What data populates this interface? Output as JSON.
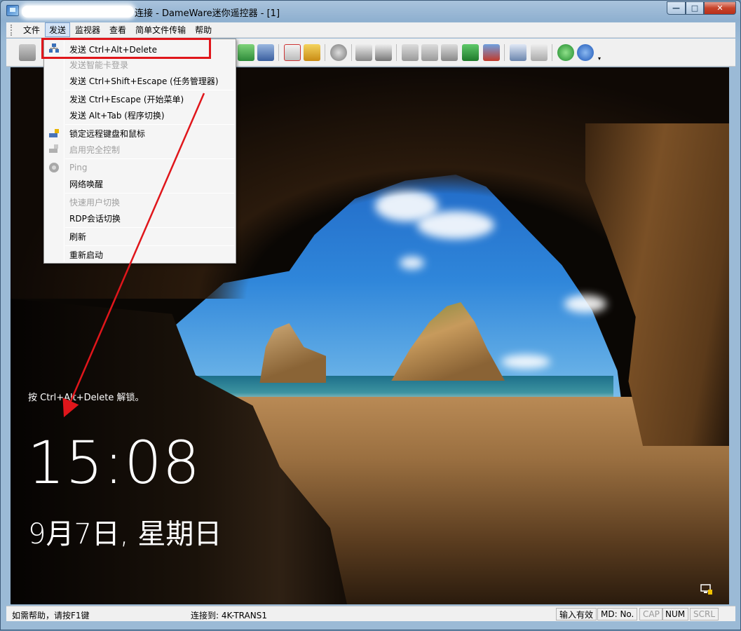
{
  "window": {
    "title": "连接 - DameWare迷你遥控器 - [1]"
  },
  "menubar": {
    "items": [
      "文件",
      "发送",
      "监视器",
      "查看",
      "简单文件传输",
      "帮助"
    ]
  },
  "send_menu": {
    "items": [
      {
        "label": "发送 Ctrl+Alt+Delete",
        "enabled": true,
        "icon": "network-computers-icon"
      },
      {
        "label": "发送智能卡登录",
        "enabled": false
      },
      {
        "label": "发送 Ctrl+Shift+Escape (任务管理器)",
        "enabled": true
      },
      {
        "label": "发送 Ctrl+Escape (开始菜单)",
        "enabled": true
      },
      {
        "label": "发送 Alt+Tab (程序切换)",
        "enabled": true
      },
      {
        "label": "锁定远程键盘和鼠标",
        "enabled": true,
        "icon": "lock-keyboard-icon"
      },
      {
        "label": "启用完全控制",
        "enabled": false,
        "icon": "full-control-icon"
      },
      {
        "label": "Ping",
        "enabled": false,
        "icon": "ping-icon"
      },
      {
        "label": "网络唤醒",
        "enabled": true
      },
      {
        "label": "快速用户切换",
        "enabled": false
      },
      {
        "label": "RDP会话切换",
        "enabled": true
      },
      {
        "label": "刷新",
        "enabled": true
      },
      {
        "label": "重新启动",
        "enabled": true
      }
    ]
  },
  "lockscreen": {
    "hint": "按 Ctrl+Alt+Delete 解锁。",
    "time": "15:08",
    "date": "9月7日, 星期日"
  },
  "statusbar": {
    "help": "如需帮助，请按F1键",
    "connected": "连接到: 4K-TRANS1",
    "input": "输入有效",
    "md": "MD: No.",
    "cap": "CAP",
    "num": "NUM",
    "scrl": "SCRL"
  },
  "colors": {
    "highlight_box": "#e0161b",
    "annotation_arrow": "#e0161b",
    "titlebar": "#a9c3dc"
  }
}
